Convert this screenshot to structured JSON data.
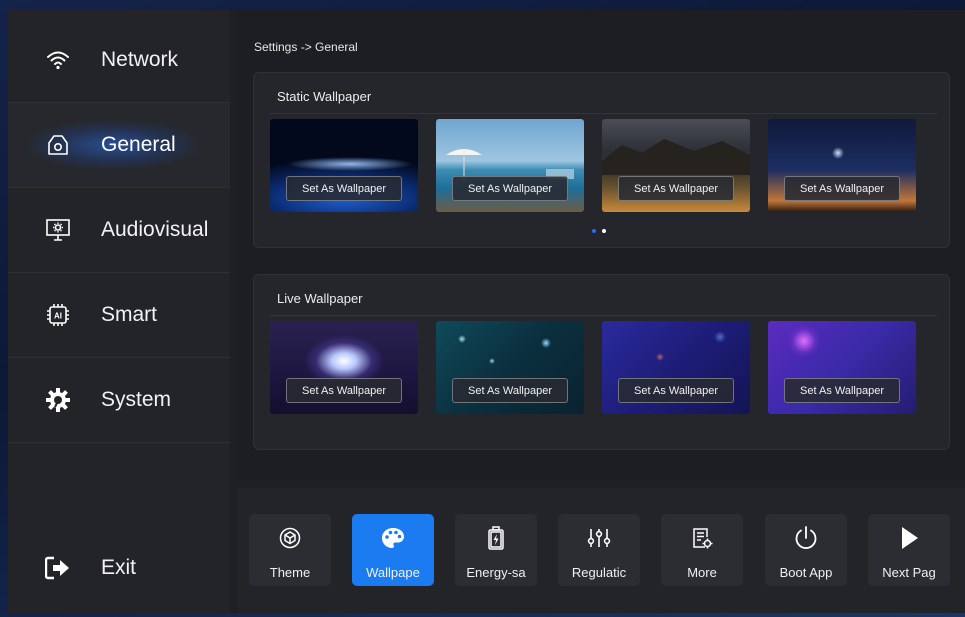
{
  "sidebar": {
    "items": [
      {
        "label": "Network",
        "icon": "wifi-icon"
      },
      {
        "label": "General",
        "icon": "general-icon",
        "active": true
      },
      {
        "label": "Audiovisual",
        "icon": "monitor-icon"
      },
      {
        "label": "Smart",
        "icon": "ai-chip-icon"
      },
      {
        "label": "System",
        "icon": "gear-icon"
      }
    ],
    "exit_label": "Exit"
  },
  "breadcrumb": "Settings -> General",
  "static_wallpaper": {
    "title": "Static Wallpaper",
    "set_labels": [
      "Set As Wallpaper",
      "Set As Wallpaper",
      "Set As Wallpaper",
      "Set As Wallpaper"
    ],
    "page_dots": {
      "count": 2,
      "active": 0
    }
  },
  "live_wallpaper": {
    "title": "Live Wallpaper",
    "set_labels": [
      "Set As Wallpaper",
      "Set As Wallpaper",
      "Set As Wallpaper",
      "Set As Wallpaper"
    ]
  },
  "toolbar": {
    "items": [
      {
        "label": "Theme",
        "icon": "theme-cube-icon"
      },
      {
        "label": "Wallpape",
        "icon": "palette-icon",
        "active": true
      },
      {
        "label": "Energy-sa",
        "icon": "battery-icon"
      },
      {
        "label": "Regulatic",
        "icon": "sliders-icon"
      },
      {
        "label": "More",
        "icon": "more-settings-icon"
      },
      {
        "label": "Boot App",
        "icon": "power-icon"
      },
      {
        "label": "Next Pag",
        "icon": "play-next-icon"
      }
    ]
  },
  "colors": {
    "accent": "#1a7cf0",
    "background": "#1f2024",
    "panel": "#25262b"
  }
}
